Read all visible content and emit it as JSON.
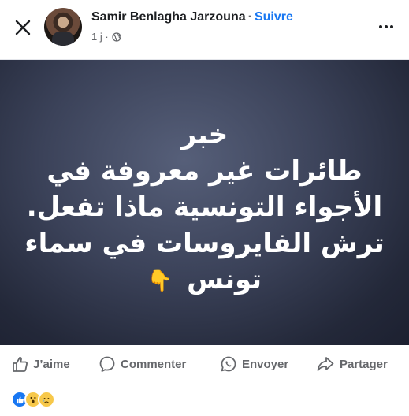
{
  "post": {
    "author": "Samir Benlagha Jarzouna",
    "separator": "·",
    "follow_label": "Suivre",
    "time": "1 j ·",
    "privacy_icon": "globe-icon",
    "image_text": [
      "خبر",
      "طائرات غير معروفة في",
      "الأجواء التونسية ماذا تفعل.",
      "ترش الفايروسات في سماء",
      "تونس"
    ],
    "pointer_emoji": "👇"
  },
  "actions": {
    "like": "J’aime",
    "comment": "Commenter",
    "share_send": "Envoyer",
    "share": "Partager"
  },
  "reactions": [
    "like-icon",
    "wow-icon",
    "sad-icon"
  ],
  "colors": {
    "accent": "#1877f2",
    "text_primary": "#1c1e21",
    "text_secondary": "#65676b",
    "image_bg": "#3b4259"
  }
}
